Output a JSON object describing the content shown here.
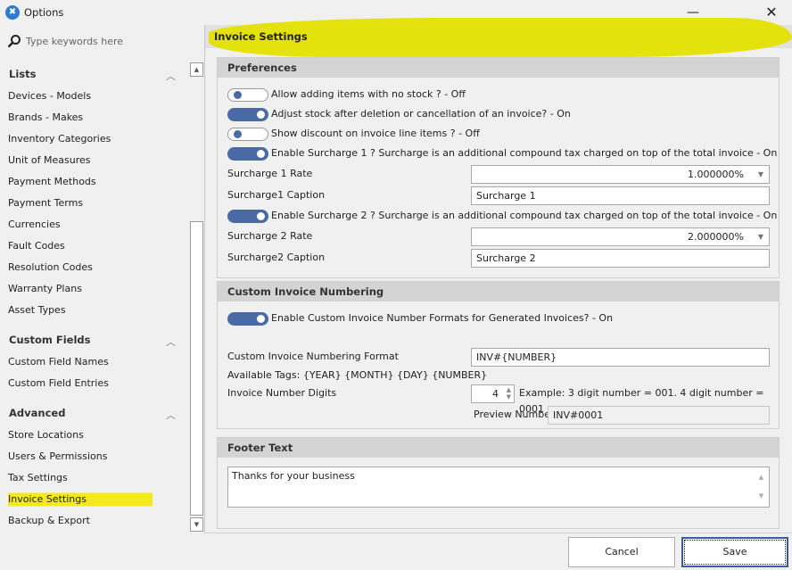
{
  "window": {
    "title": "Options",
    "minimize_label": "—",
    "close_label": "✕",
    "icon": "tools-icon"
  },
  "sidebar": {
    "search_placeholder": "Type keywords here",
    "groups": [
      {
        "title": "Lists",
        "items": [
          "Devices - Models",
          "Brands - Makes",
          "Inventory Categories",
          "Unit of Measures",
          "Payment Methods",
          "Payment Terms",
          "Currencies",
          "Fault Codes",
          "Resolution Codes",
          "Warranty Plans",
          "Asset Types"
        ]
      },
      {
        "title": "Custom Fields",
        "items": [
          "Custom Field Names",
          "Custom Field Entries"
        ]
      },
      {
        "title": "Advanced",
        "items": [
          "Store Locations",
          "Users & Permissions",
          "Tax Settings",
          "Invoice Settings",
          "Backup & Export"
        ]
      }
    ],
    "active_item": "Invoice Settings",
    "highlight_color": "#f3ea1b"
  },
  "main": {
    "page_title": "Invoice Settings",
    "preferences": {
      "title": "Preferences",
      "toggles": [
        {
          "label": "Allow adding items with no stock ? - Off",
          "on": false
        },
        {
          "label": "Adjust stock after deletion or cancellation of an invoice? - On",
          "on": true
        },
        {
          "label": "Show discount on invoice line items ? - Off",
          "on": false
        },
        {
          "label": "Enable Surcharge 1 ? Surcharge is an additional compound tax charged on top of the total invoice - On",
          "on": true
        },
        {
          "label": "Enable Surcharge 2 ? Surcharge is an additional compound tax charged on top of the total invoice - On",
          "on": true
        }
      ],
      "surcharge1_rate_label": "Surcharge 1 Rate",
      "surcharge1_rate_value": "1.000000%",
      "surcharge1_caption_label": "Surcharge1 Caption",
      "surcharge1_caption_value": "Surcharge 1",
      "surcharge2_rate_label": "Surcharge 2 Rate",
      "surcharge2_rate_value": "2.000000%",
      "surcharge2_caption_label": "Surcharge2 Caption",
      "surcharge2_caption_value": "Surcharge 2"
    },
    "numbering": {
      "title": "Custom Invoice Numbering",
      "toggle_label": "Enable Custom Invoice Number Formats for Generated Invoices? -  On",
      "toggle_on": true,
      "format_label": "Custom Invoice Numbering Format",
      "format_value": "INV#{NUMBER}",
      "tags_text": "Available Tags: {YEAR} {MONTH} {DAY} {NUMBER}",
      "digits_label": "Invoice Number Digits",
      "digits_value": "4",
      "digits_example": "Example: 3 digit number = 001. 4 digit number = 0001",
      "preview_label": "Preview Number",
      "preview_value": "INV#0001"
    },
    "footer": {
      "title": "Footer Text",
      "text": "Thanks for your business"
    }
  },
  "actions": {
    "cancel_label": "Cancel",
    "save_label": "Save"
  },
  "colors": {
    "toggle_on": "#4a6aa5",
    "highlight": "#e4e100"
  }
}
